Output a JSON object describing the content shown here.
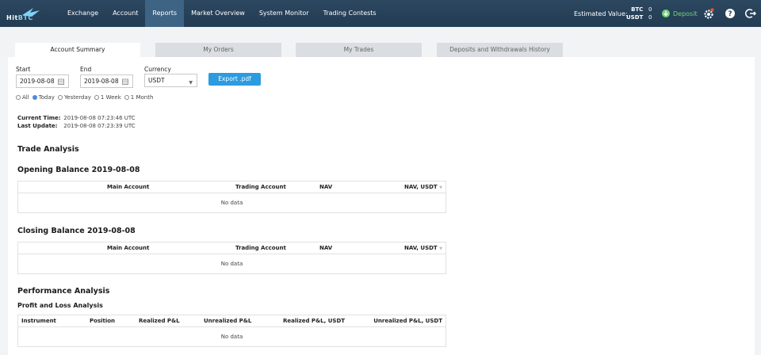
{
  "nav": {
    "items": [
      "Exchange",
      "Account",
      "Reports",
      "Market Overview",
      "System Monitor",
      "Trading Contests"
    ],
    "active": "Reports"
  },
  "header": {
    "est_label": "Estimated Value:",
    "balances": [
      {
        "currency": "BTC",
        "value": "0"
      },
      {
        "currency": "USDT",
        "value": "0"
      }
    ],
    "deposit_label": "Deposit"
  },
  "tabs": [
    "Account Summary",
    "My Orders",
    "My Trades",
    "Deposits and Withdrawals History"
  ],
  "form": {
    "start_label": "Start",
    "start_value": "2019-08-08",
    "end_label": "End",
    "end_value": "2019-08-08",
    "currency_label": "Currency",
    "currency_value": "USDT",
    "export_label": "Export .pdf"
  },
  "ranges": [
    {
      "label": "All",
      "selected": false
    },
    {
      "label": "Today",
      "selected": true
    },
    {
      "label": "Yesterday",
      "selected": false
    },
    {
      "label": "1 Week",
      "selected": false
    },
    {
      "label": "1 Month",
      "selected": false
    }
  ],
  "info": {
    "current_time_label": "Current Time:",
    "current_time": "2019-08-08 07:23:46 UTC",
    "last_update_label": "Last Update:",
    "last_update": "2019-08-08 07:23:39 UTC"
  },
  "trade_analysis_title": "Trade Analysis",
  "opening": {
    "title": "Opening Balance 2019-08-08",
    "columns": [
      "Main Account",
      "Trading Account",
      "NAV",
      "NAV, USDT"
    ],
    "empty": "No data"
  },
  "closing": {
    "title": "Closing Balance 2019-08-08",
    "columns": [
      "Main Account",
      "Trading Account",
      "NAV",
      "NAV, USDT"
    ],
    "empty": "No data"
  },
  "performance_title": "Performance Analysis",
  "pnl": {
    "title": "Profit and Loss Analysis",
    "columns": [
      "Instrument",
      "Position",
      "Realized P&L",
      "Unrealized P&L",
      "Realized P&L, USDT",
      "Unrealized P&L, USDT"
    ],
    "empty": "No data"
  },
  "colors": {
    "accent": "#2d9be0",
    "nav_bg": "#2c4760",
    "deposit": "#74d27b"
  }
}
